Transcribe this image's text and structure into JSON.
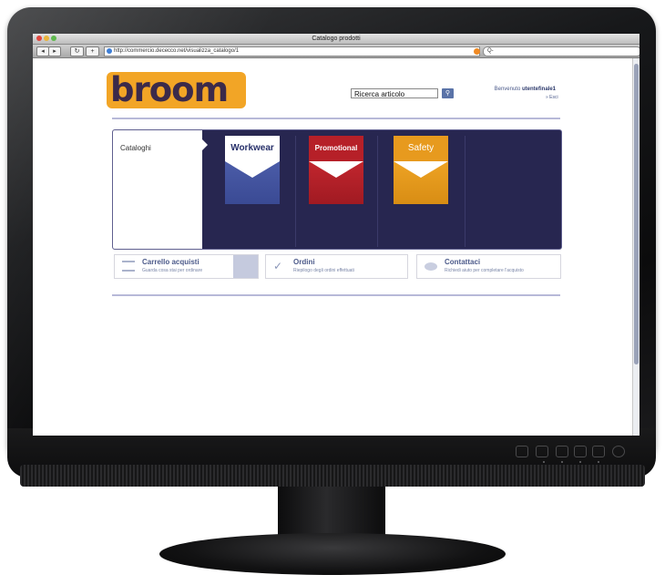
{
  "browser": {
    "window_title": "Catalogo prodotti",
    "url": "http://commercio.dececco.net/visualizza_catalogo/1",
    "search_placeholder": "Q-",
    "back_label": "◂",
    "forward_label": "▸",
    "reload_label": "↻",
    "add_label": "+"
  },
  "page": {
    "logo_text": "broom",
    "search": {
      "value": "Ricerca articolo",
      "button_icon": "search-icon"
    },
    "welcome": {
      "prefix": "Benvenuto ",
      "user": "utentefinale1",
      "logout": "» Esci"
    },
    "catalogs": {
      "label": "Cataloghi",
      "items": [
        {
          "label": "Workwear",
          "color": "#4b5ca8",
          "text_color": "#27306a"
        },
        {
          "label": "Promotional",
          "color": "#b62028",
          "text_color": "#ffffff",
          "cap_color": "#b62028"
        },
        {
          "label": "Safety",
          "color": "#e79a1e",
          "text_color": "#ffffff",
          "cap_color": "#e79a1e"
        }
      ]
    },
    "links": [
      {
        "title": "Carrello acquisti",
        "subtitle": "Guarda cosa stai per ordinare",
        "icon": "cart-icon"
      },
      {
        "title": "Ordini",
        "subtitle": "Riepilogo degli ordini effettuati",
        "icon": "checkmark-icon"
      },
      {
        "title": "Contattaci",
        "subtitle": "Richiedi aiuto per completare l'acquisto",
        "icon": "speech-bubble-icon"
      }
    ]
  },
  "colors": {
    "logo_bg": "#f2a526",
    "panel_bg": "#272650",
    "accent": "#5a73a8"
  }
}
